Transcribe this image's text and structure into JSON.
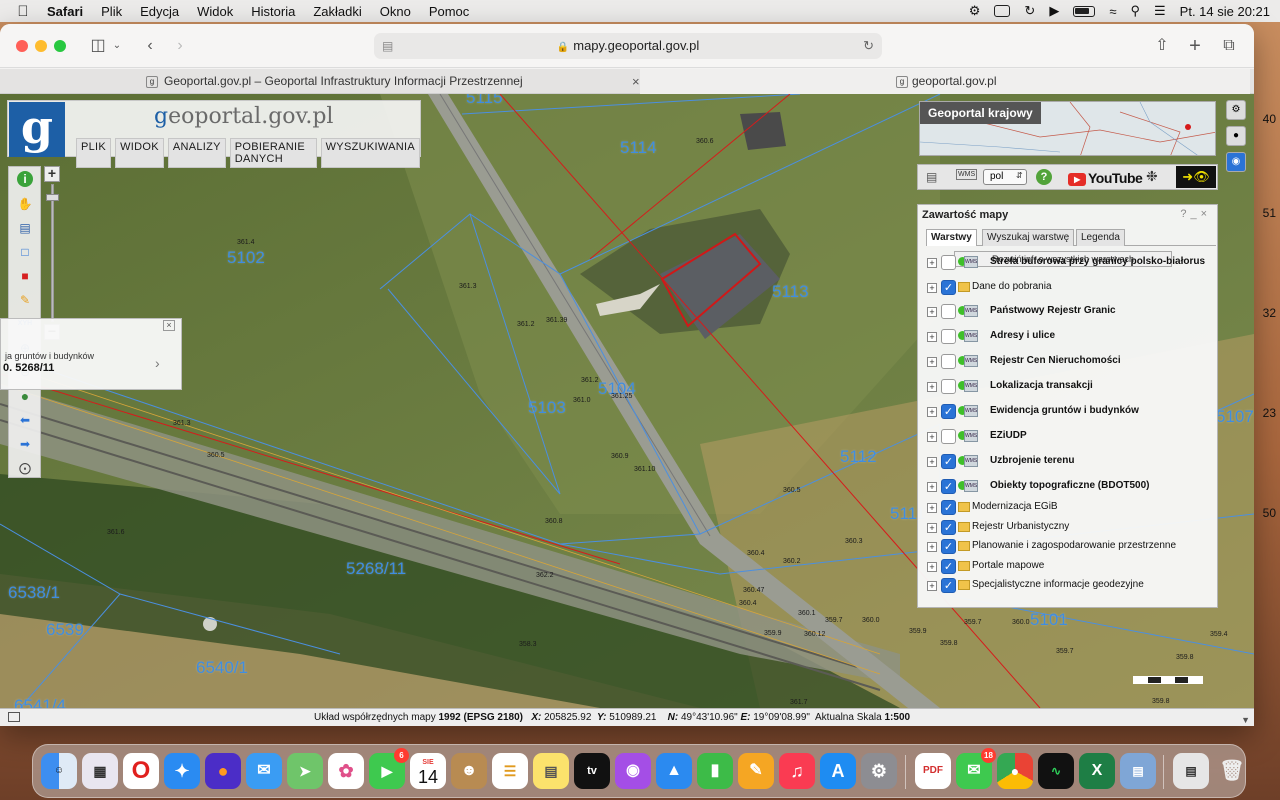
{
  "menubar": {
    "apple": "",
    "items": [
      "Safari",
      "Plik",
      "Edycja",
      "Widok",
      "Historia",
      "Zakładki",
      "Okno",
      "Pomoc"
    ],
    "datetime": "Pt. 14 sie  20:21"
  },
  "browser": {
    "address": "mapy.geoportal.gov.pl",
    "tabs": [
      {
        "title": "Geoportal.gov.pl – Geoportal Infrastruktury Informacji Przestrzennej"
      },
      {
        "title": "geoportal.gov.pl"
      }
    ],
    "close_tab_glyph": "×"
  },
  "geoportal": {
    "title_prefix": "g",
    "title_rest": "eoportal.gov.pl",
    "logo_letter": "g",
    "menu": [
      "PLIK",
      "WIDOK",
      "ANALIZY",
      "POBIERANIE DANYCH",
      "WYSZUKIWANIA"
    ]
  },
  "search_popup": {
    "label": "ja gruntów i budynków",
    "value": "0.    5268/11"
  },
  "overview": {
    "title": "Geoportal krajowy"
  },
  "right_toolbar": {
    "lang": "pol",
    "youtube": "YouTube"
  },
  "layers_panel": {
    "title": "Zawartość mapy",
    "tabs": [
      "Warstwy",
      "Wyszukaj warstwę",
      "Legenda"
    ],
    "expand_button": "Rozwiń inf. o wszystkich warstwach",
    "layers": [
      {
        "name": "Strefa buforowa przy granicy polsko-białorus",
        "checked": false,
        "bold": true,
        "kind": "service"
      },
      {
        "name": "Dane do pobrania",
        "checked": true,
        "bold": false,
        "kind": "folder"
      },
      {
        "name": "Państwowy Rejestr Granic",
        "checked": false,
        "bold": true,
        "kind": "service"
      },
      {
        "name": "Adresy i ulice",
        "checked": false,
        "bold": true,
        "kind": "service"
      },
      {
        "name": "Rejestr Cen Nieruchomości",
        "checked": false,
        "bold": true,
        "kind": "service"
      },
      {
        "name": "Lokalizacja transakcji",
        "checked": false,
        "bold": true,
        "kind": "service"
      },
      {
        "name": "Ewidencja gruntów i budynków",
        "checked": true,
        "bold": true,
        "kind": "service"
      },
      {
        "name": "EZiUDP",
        "checked": false,
        "bold": true,
        "kind": "service"
      },
      {
        "name": "Uzbrojenie terenu",
        "checked": true,
        "bold": true,
        "kind": "service"
      },
      {
        "name": "Obiekty topograficzne (BDOT500)",
        "checked": true,
        "bold": true,
        "kind": "service"
      },
      {
        "name": "Modernizacja EGiB",
        "checked": true,
        "bold": false,
        "kind": "folder"
      },
      {
        "name": "Rejestr Urbanistyczny",
        "checked": true,
        "bold": false,
        "kind": "folder"
      },
      {
        "name": "Planowanie i zagospodarowanie przestrzenne",
        "checked": true,
        "bold": false,
        "kind": "folder"
      },
      {
        "name": "Portale mapowe",
        "checked": true,
        "bold": false,
        "kind": "folder"
      },
      {
        "name": "Specjalistyczne informacje geodezyjne",
        "checked": true,
        "bold": false,
        "kind": "folder"
      }
    ]
  },
  "parcels": [
    "5115",
    "5114",
    "5102",
    "5113",
    "5103",
    "5104",
    "5112",
    "5111",
    "5268/11",
    "6538/1",
    "6539",
    "6540/1",
    "5101",
    "5107",
    "6541/4"
  ],
  "elevations": [
    "360.6",
    "361.4",
    "361.3",
    "361.2",
    "361.39",
    "361.2",
    "361.25",
    "361.0",
    "361.3",
    "360.9",
    "361.10",
    "360.8",
    "360.5",
    "360.4",
    "360.3",
    "360.2",
    "360.47",
    "360.4",
    "360.1",
    "359.7",
    "360.0",
    "359.9",
    "359.8",
    "359.7",
    "360.0",
    "359.4",
    "359.9",
    "360.12",
    "359.7",
    "361.6",
    "362.2",
    "360.5",
    "358.3",
    "361.7",
    "359.8",
    "359.8"
  ],
  "status": {
    "system_label": "Układ współrzędnych mapy",
    "system_value": "1992 (EPSG 2180)",
    "x_label": "X:",
    "x_value": "205825.92",
    "y_label": "Y:",
    "y_value": "510989.21",
    "n_label": "N:",
    "n_value": "49°43'10.96\"",
    "e_label": "E:",
    "e_value": "19°09'08.99\"",
    "scale_label": "Aktualna Skala",
    "scale_value": "1:500"
  },
  "desktop_strip": [
    "40",
    "51",
    "32",
    "23",
    "50"
  ],
  "dock": {
    "calendar_month": "SIE",
    "calendar_day": "14",
    "facetime_badge": "6",
    "messages_badge": "18",
    "tv_label": "tv",
    "pdf_label": "PDF"
  }
}
